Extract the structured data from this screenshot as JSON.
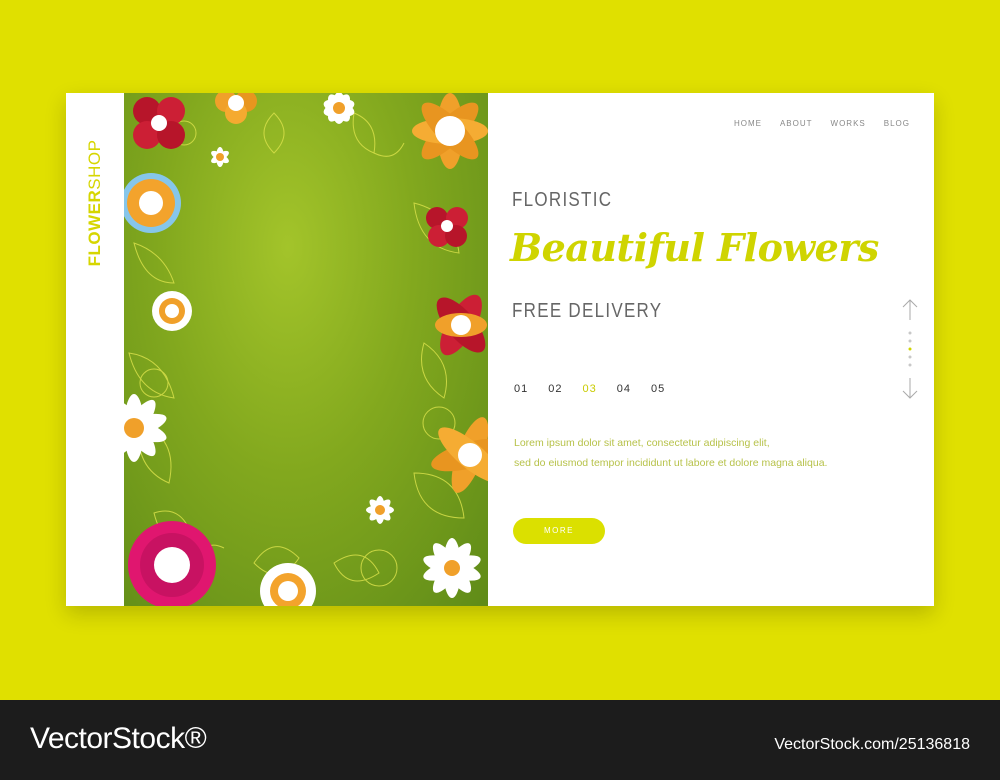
{
  "brand": {
    "part1": "FLOWER",
    "part2": "SHOP"
  },
  "nav": {
    "items": [
      "HOME",
      "ABOUT",
      "WORKS",
      "BLOG"
    ]
  },
  "hero": {
    "kicker": "FLORISTIC",
    "headline": "Beautiful Flowers",
    "subheadline": "FREE DELIVERY"
  },
  "pager": {
    "items": [
      "01",
      "02",
      "03",
      "04",
      "05"
    ],
    "active": "03"
  },
  "description": {
    "line1": "Lorem ipsum dolor sit amet, consectetur adipiscing elit,",
    "line2": "sed do eiusmod tempor incididunt ut labore et dolore magna aliqua."
  },
  "cta": {
    "label": "MORE"
  },
  "watermark": {
    "left": "VectorStock®",
    "right": "VectorStock.com/25136818"
  },
  "colors": {
    "accent": "#dbe000",
    "background": "#e0e000",
    "art_green": "#82a81e",
    "text_gray": "#666666"
  },
  "icons": [
    "arrow-up-icon",
    "arrow-down-icon",
    "scroll-dots-icon"
  ]
}
